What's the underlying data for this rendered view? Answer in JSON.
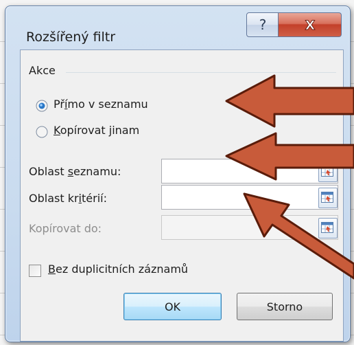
{
  "dialog": {
    "title": "Rozšířený filtr",
    "help_glyph": "?",
    "close_glyph": "X"
  },
  "group": {
    "label": "Akce"
  },
  "options": {
    "in_place": {
      "pre": "Př",
      "accel": "í",
      "post": "mo v seznamu",
      "selected": true
    },
    "copy": {
      "pre": "",
      "accel": "K",
      "post": "opírovat jinam",
      "selected": false
    }
  },
  "fields": {
    "list_range": {
      "pre": "Oblast ",
      "accel": "s",
      "post": "eznamu:",
      "value": ""
    },
    "criteria_range": {
      "pre": "Oblast kr",
      "accel": "i",
      "post": "térií:",
      "value": ""
    },
    "copy_to": {
      "label": "Kopírovat do:",
      "value": "",
      "disabled": true
    }
  },
  "unique_records": {
    "pre": "",
    "accel": "B",
    "post": "ez duplicitních záznamů",
    "checked": false
  },
  "buttons": {
    "ok": "OK",
    "cancel": "Storno"
  },
  "colors": {
    "arrow": "#c85b3a",
    "arrow_outline": "#5a1c0a"
  }
}
